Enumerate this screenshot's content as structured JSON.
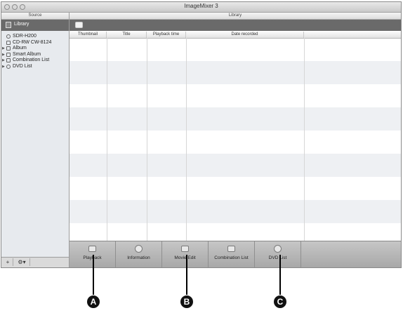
{
  "window": {
    "title": "ImageMixer 3"
  },
  "sidebar": {
    "header": "Source",
    "library_label": "Library",
    "items": [
      {
        "label": "SDR-H200",
        "icon": "camera-icon",
        "expand": false
      },
      {
        "label": "CD-RW  CW-8124",
        "icon": "drive-icon",
        "expand": false
      },
      {
        "label": "Album",
        "icon": "album-icon",
        "expand": true
      },
      {
        "label": "Smart Album",
        "icon": "smart-album-icon",
        "expand": true
      },
      {
        "label": "Combination List",
        "icon": "list-icon",
        "expand": true
      },
      {
        "label": "DVD List",
        "icon": "dvd-icon",
        "expand": true
      }
    ],
    "bottom_buttons": [
      {
        "label": "+",
        "icon": "add-icon"
      },
      {
        "label": "⚙▾",
        "icon": "gear-icon"
      }
    ]
  },
  "main": {
    "header": "Library",
    "columns": [
      "Thumbnail",
      "Title",
      "Playback time",
      "Date recorded"
    ]
  },
  "toolbar": {
    "buttons": [
      {
        "label": "Playback",
        "icon": "playback-icon"
      },
      {
        "label": "Information",
        "icon": "information-icon"
      },
      {
        "label": "Movie Edit",
        "icon": "movie-edit-icon"
      },
      {
        "label": "Combination List",
        "icon": "combination-list-icon"
      },
      {
        "label": "DVD List",
        "icon": "dvd-list-icon"
      }
    ]
  },
  "callouts": [
    "A",
    "B",
    "C"
  ]
}
